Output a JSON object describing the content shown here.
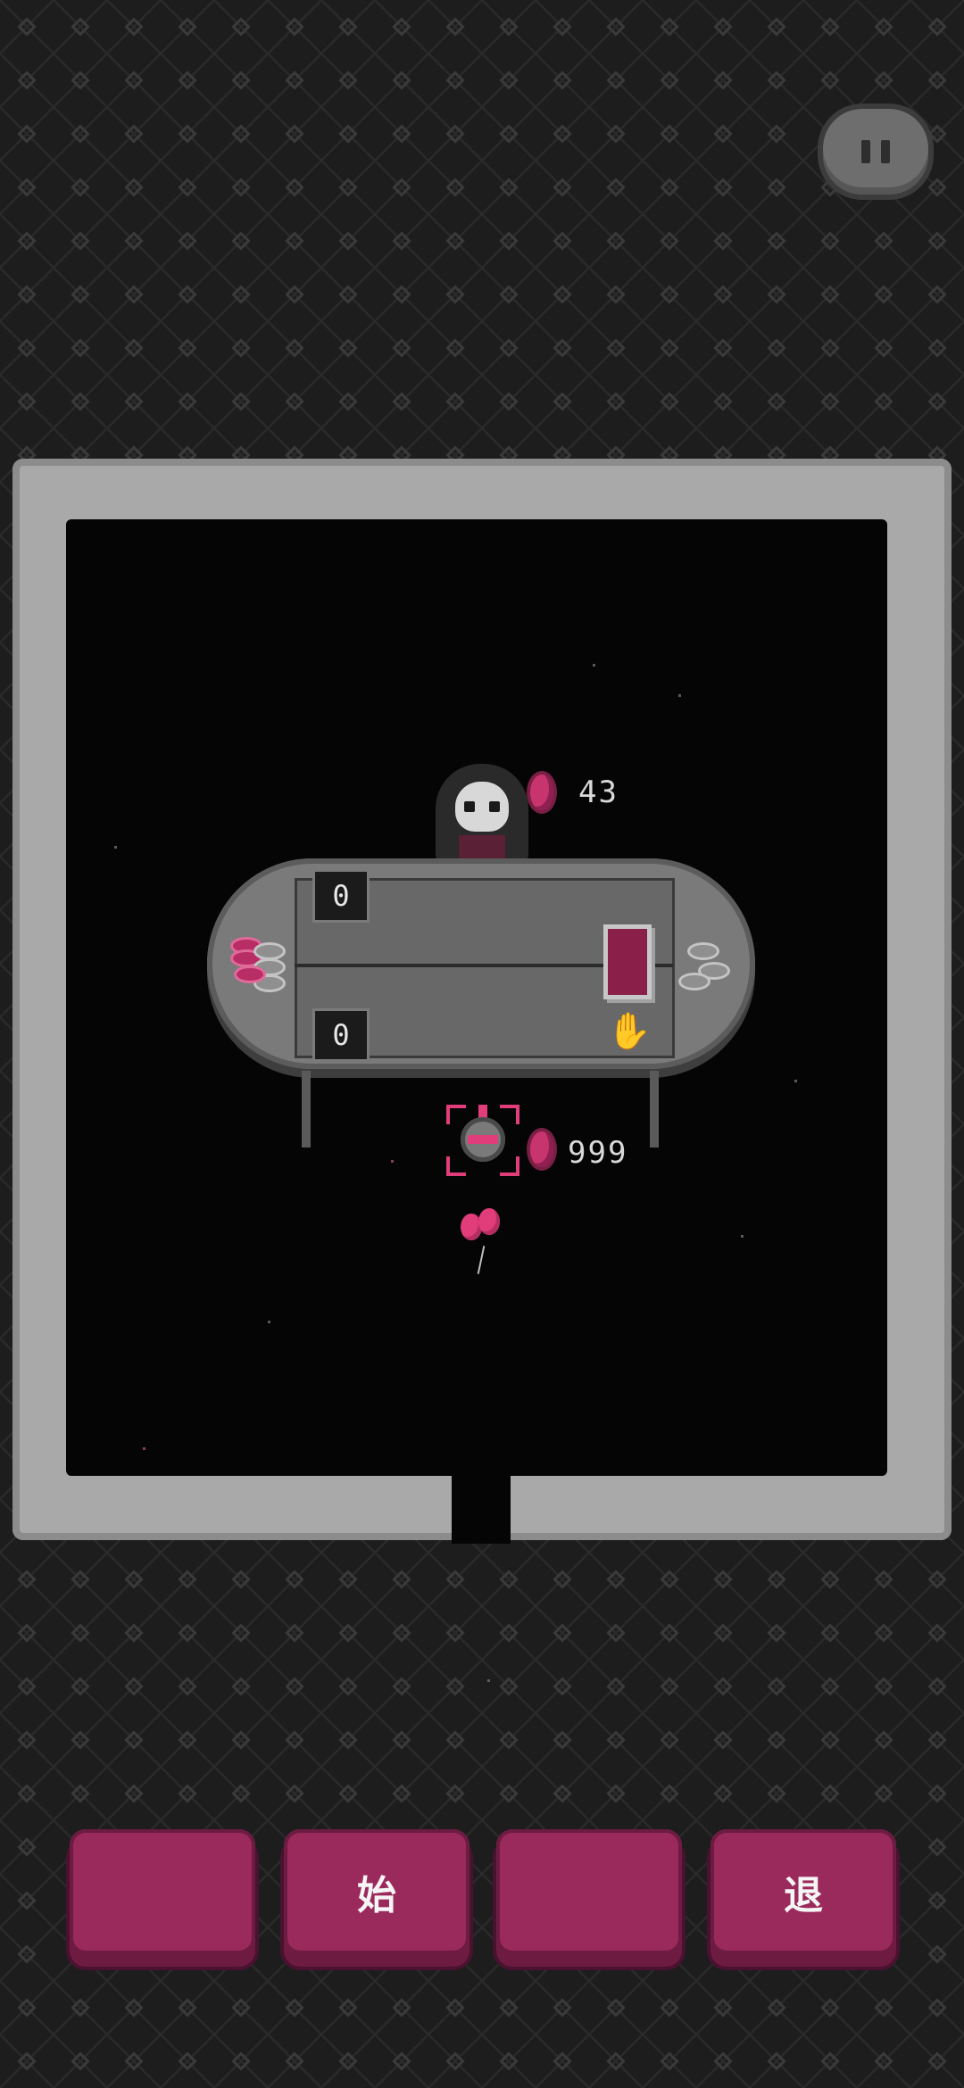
{
  "hud": {
    "pause_icon": "pause-icon"
  },
  "dealer": {
    "gem_count": "43"
  },
  "player": {
    "gem_count": "999"
  },
  "table": {
    "dealer_score": "0",
    "player_score": "0"
  },
  "buttons": [
    {
      "label": ""
    },
    {
      "label": "始"
    },
    {
      "label": ""
    },
    {
      "label": "退"
    }
  ],
  "colors": {
    "accent": "#9a2a5c",
    "gem": "#c8346e",
    "wall": "#a9a9a9"
  }
}
